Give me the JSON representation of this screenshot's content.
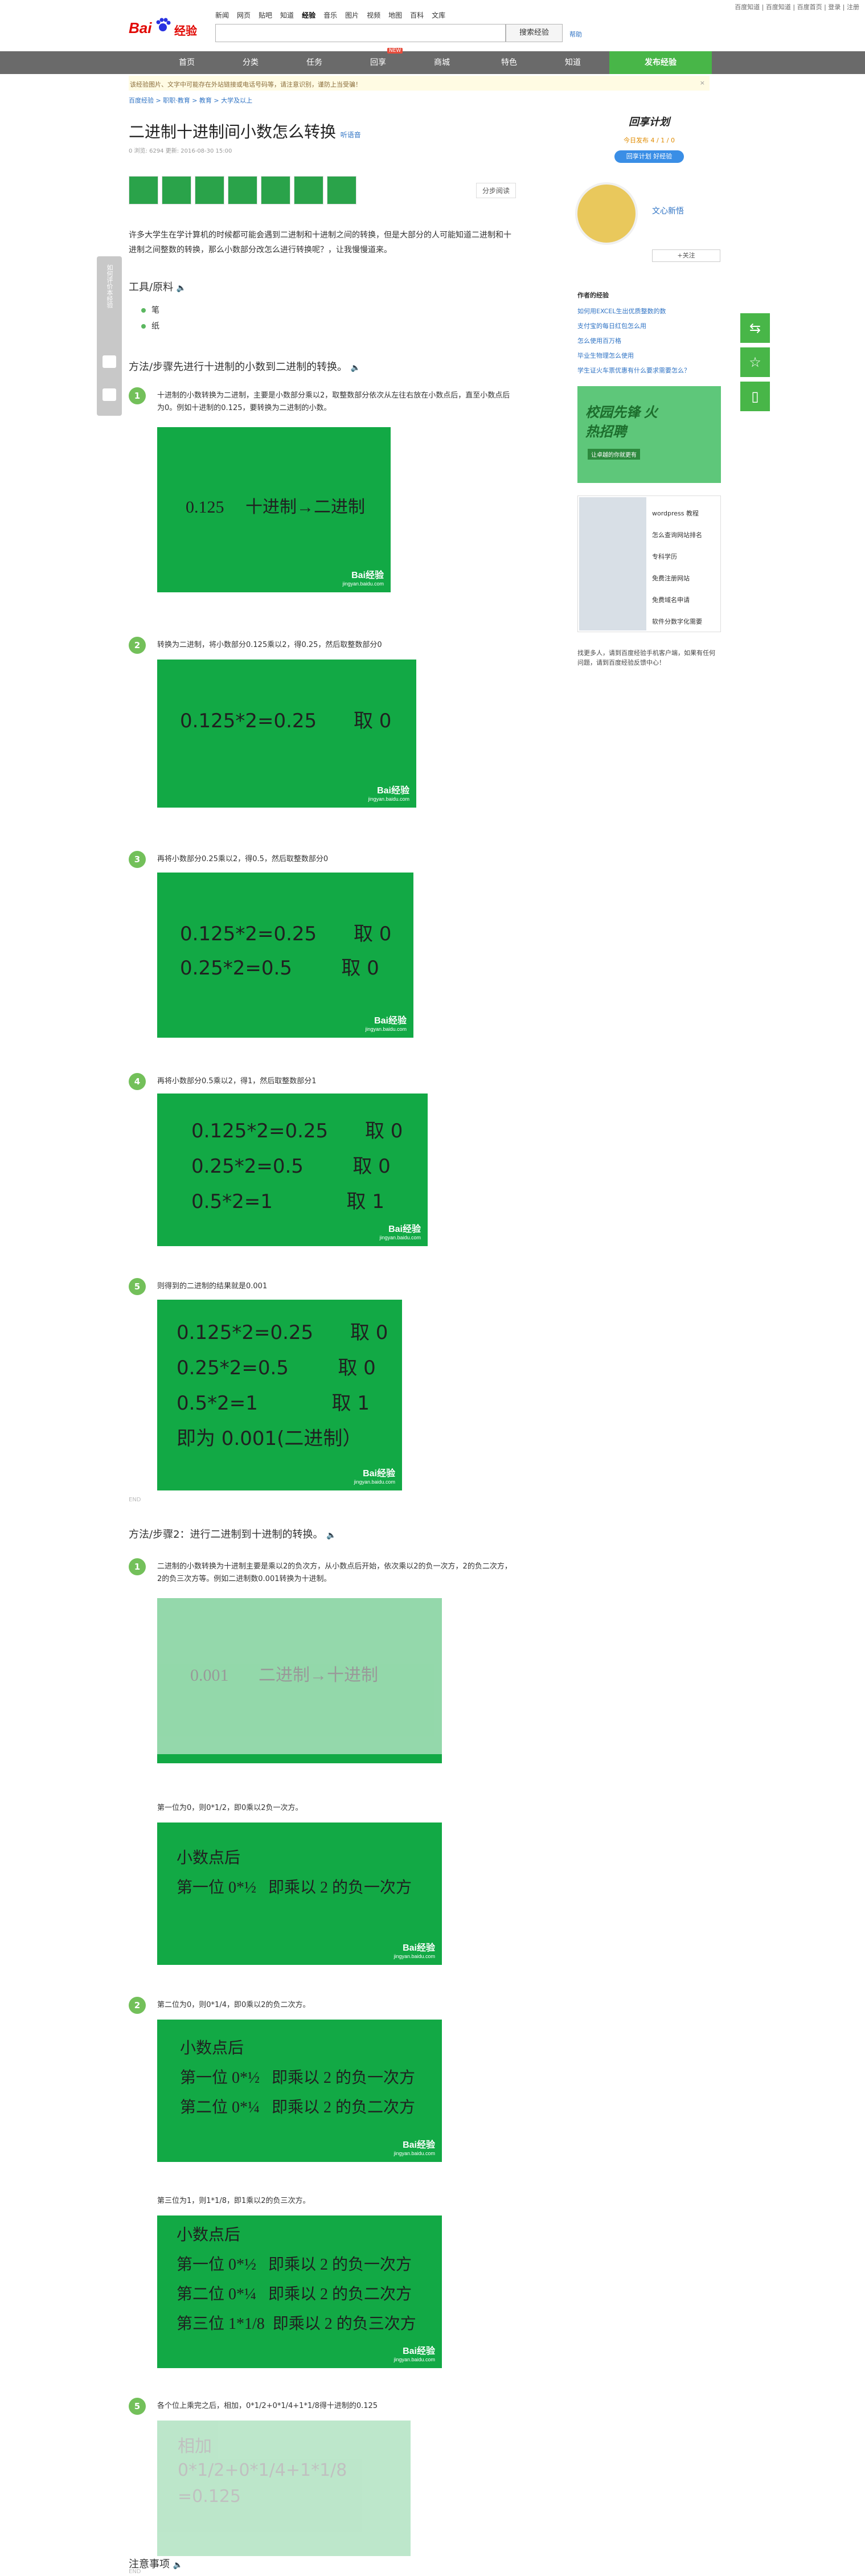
{
  "top": {
    "links": "百度知道 | 百度知道 | 百度首页 | 登录 | 注册"
  },
  "logo": {
    "bai": "Bai",
    "jy": "经验"
  },
  "channels": [
    "新闻",
    "网页",
    "贴吧",
    "知道",
    "经验",
    "音乐",
    "图片",
    "视频",
    "地图",
    "百科",
    "文库"
  ],
  "search": {
    "placeholder": "",
    "button": "搜索经验",
    "help": "帮助"
  },
  "nav": [
    "首页",
    "分类",
    "任务",
    "回享",
    "商城",
    "特色",
    "知道"
  ],
  "nav_new": "NEW",
  "publish": "发布经验",
  "notice": {
    "text": "该经验图片、文字中可能存在外站链接或电话号码等，请注意识别，谨防上当受骗！",
    "close": "×"
  },
  "breadcrumb": "百度经验 > 职职·教育 > 教育 > 大学及以上",
  "title": "二进制十进制间小数怎么转换",
  "listen": "听语音",
  "meta": "0    浏览: 6294    更新: 2016-08-30 15:00",
  "thumbs_cat": "分步阅读",
  "intro": "许多大学生在学计算机的时候都可能会遇到二进制和十进制之间的转换，但是大部分的人可能知道二进制和十进制之间整数的转换，那么小数部分改怎么进行转换呢？，让我慢慢道来。",
  "tools": {
    "heading": "工具/原料",
    "items": [
      "笔",
      "纸"
    ]
  },
  "m1": {
    "heading": "方法/步骤先进行十进制的小数到二进制的转换。",
    "s1": "十进制的小数转换为二进制，主要是小数部分乘以2，取整数部分依次从左往右放在小数点后，直至小数点后为0。例如十进制的0.125，要转换为二进制的小数。",
    "s2": "转换为二进制，将小数部分0.125乘以2，得0.25，然后取整数部分0",
    "s3": "再将小数部分0.25乘以2，得0.5，然后取整数部分0",
    "s4": "再将小数部分0.5乘以2，得1，然后取整数部分1",
    "s5": "则得到的二进制的结果就是0.001"
  },
  "m2": {
    "heading": "方法/步骤2：进行二进制到十进制的转换。",
    "s1": "二进制的小数转换为十进制主要是乘以2的负次方，从小数点后开始，依次乘以2的负一次方，2的负二次方，2的负三次方等。例如二进制数0.001转换为十进制。",
    "s1b": "第一位为0，则0*1/2，即0乘以2负一次方。",
    "s2": "第二位为0，则0*1/4，即0乘以2的负二次方。",
    "s2b": "第三位为1，则1*1/8，即1乘以2的负三次方。",
    "s3": "各个位上乘完之后，相加，0*1/2+0*1/4+1*1/8得十进制的0.125"
  },
  "img": {
    "a": "0.125     十进制→二进制",
    "b1": "0.125*2=0.25      取 0",
    "b2": "0.25*2=0.5        取 0",
    "b3": "0.5*2=1            取 1",
    "b4": "即为 0.001(二进制）",
    "c": "0.001       二进制→十进制",
    "d1": "小数点后",
    "d2": "第一位 0*½   即乘以 2 的负一次方",
    "d3": "第二位 0*¼   即乘以 2 的负二次方",
    "d4": "第三位 1*1/8  即乘以 2 的负三次方",
    "e1": "相加",
    "e2": "0*1/2+0*1/4+1*1/8",
    "e3": "=0.125",
    "wm": "Bai经验",
    "wms": "jingyan.baidu.com"
  },
  "notes_heading": "注意事项",
  "end": "END",
  "sidebar": {
    "brand": "回享计划",
    "stats": "今日发布  4 / 1 / 0",
    "plan_btn": "回享计划  好经验",
    "author": "文心新悟",
    "follow": "+关注",
    "author_exp": "作者的经验",
    "exp": [
      "如何用EXCEL生出优质整数的数",
      "支付宝的每日红包怎么用",
      "怎么使用百万格",
      "毕业生物理怎么使用",
      "学生证火车票优惠有什么要求需要怎么？"
    ],
    "ad": "校园先锋 火热招聘",
    "ad_sub": "让卓越的你就更有",
    "rel": [
      "wordpress 教程",
      "怎么查询网站排名",
      "专科学历",
      "免费注册网站",
      "免费域名申请",
      "软件分数字化需要"
    ],
    "foot": "找更多人，请到百度经验手机客户端，如果有任何问题，请到百度经验反馈中心！"
  },
  "float_left": "如何评价本经验",
  "float_icons": [
    "share-icon",
    "star-icon",
    "phone-icon"
  ]
}
